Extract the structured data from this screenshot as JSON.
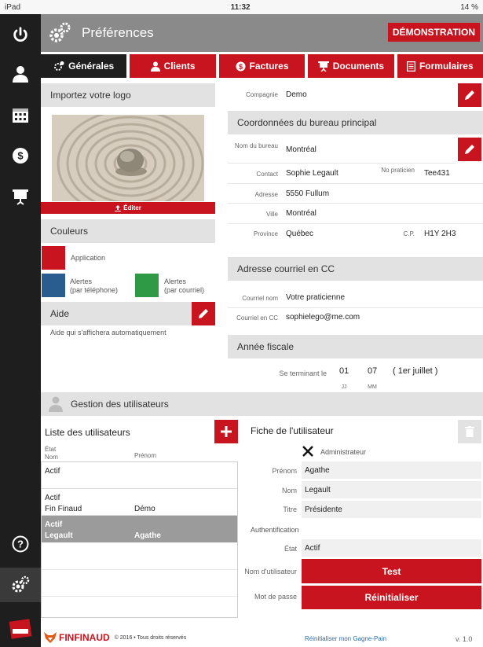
{
  "status": {
    "device": "iPad",
    "time": "11:32",
    "battery": "14 %"
  },
  "header": {
    "title": "Préférences",
    "demo_label": "DÉMONSTRATION"
  },
  "tabs": [
    {
      "label": "Générales"
    },
    {
      "label": "Clients"
    },
    {
      "label": "Factures"
    },
    {
      "label": "Documents"
    },
    {
      "label": "Formulaires"
    }
  ],
  "logo": {
    "title": "Importez votre logo",
    "edit_label": "Éditer"
  },
  "colors": {
    "title": "Couleurs",
    "application_label": "Application",
    "alerts_phone_label": "Alertes",
    "alerts_phone_sub": "(par téléphone)",
    "alerts_email_label": "Alertes",
    "alerts_email_sub": "(par courriel)",
    "application_color": "#c8141e",
    "alerts_phone_color": "#2a5d8f",
    "alerts_email_color": "#2f9a45"
  },
  "help": {
    "title": "Aide",
    "text": "Aide qui s'affichera automatiquement"
  },
  "company": {
    "label": "Compagnie",
    "value": "Demo"
  },
  "office": {
    "title": "Coordonnées du bureau principal",
    "name_label": "Nom du bureau",
    "name": "Montréal",
    "contact_label": "Contact",
    "contact": "Sophie Legault",
    "practitioner_no_label": "No praticien",
    "practitioner_no": "Tee431",
    "address_label": "Adresse",
    "address": "5550 Fullum",
    "city_label": "Ville",
    "city": "Montréal",
    "province_label": "Province",
    "province": "Québec",
    "postal_label": "C.P.",
    "postal": "H1Y 2H3"
  },
  "cc": {
    "title": "Adresse courriel en CC",
    "name_label": "Courriel nom",
    "name": "Votre praticienne",
    "email_label": "Courriel en CC",
    "email": "sophielego@me.com"
  },
  "fiscal": {
    "title": "Année fiscale",
    "ending_label": "Se terminant le",
    "day": "01",
    "month": "07",
    "day_label": "JJ",
    "month_label": "MM",
    "note": "( 1er juillet )"
  },
  "users": {
    "section_title": "Gestion des utilisateurs",
    "list_title": "Liste des utilisateurs",
    "col_state": "État",
    "col_name": "Nom",
    "col_first": "Prénom",
    "rows": [
      {
        "state": "Actif",
        "name": "",
        "first": ""
      },
      {
        "state": "Actif",
        "name": "Fin Finaud",
        "first": "Démo"
      },
      {
        "state": "Actif",
        "name": "Legault",
        "first": "Agathe"
      }
    ]
  },
  "user_card": {
    "title": "Fiche de l'utilisateur",
    "admin_label": "Administrateur",
    "first_label": "Prénom",
    "first": "Agathe",
    "name_label": "Nom",
    "name": "Legault",
    "title_label": "Titre",
    "job_title": "Présidente",
    "auth_label": "Authentification",
    "state_label": "État",
    "state": "Actif",
    "username_label": "Nom d'utilisateur",
    "username": "Test",
    "password_label": "Mot de passe",
    "reset_label": "Réinitialiser"
  },
  "footer": {
    "brand": "FINFINAUD",
    "copyright": "© 2016 • Tous droits réservés",
    "reset_link": "Réinitialiser mon Gagne-Pain",
    "version": "v. 1.0"
  }
}
